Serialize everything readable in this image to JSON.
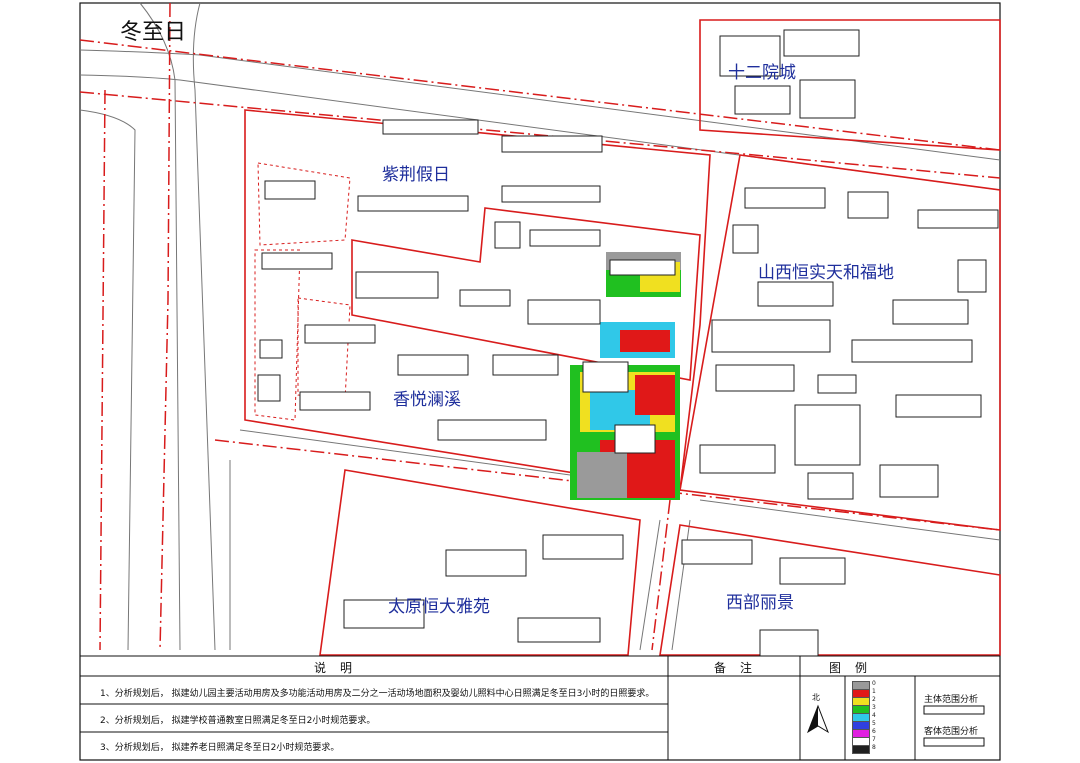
{
  "title": "冬至日",
  "districts": {
    "shierchengyuan": "十二院城",
    "zijingjiari": "紫荆假日",
    "shanxihengshi": "山西恒实天和福地",
    "xiangyuelanxi": "香悦澜溪",
    "taiyuanhengda": "太原恒大雅苑",
    "xibulijing": "西部丽景"
  },
  "title_block": {
    "explain_header": "说明",
    "remark_header": "备注",
    "legend_header": "图例",
    "notes": [
      "1、分析规划后， 拟建幼儿园主要活动用房及多功能活动用房及二分之一活动场地面积及婴幼儿照料中心日照满足冬至日3小时的日照要求。",
      "2、分析规划后， 拟建学校普通教室日照满足冬至日2小时规范要求。",
      "3、分析规划后， 拟建养老日照满足冬至日2小时规范要求。"
    ],
    "north_label": "北",
    "legend_main": "主体范围分析",
    "legend_guest": "客体范围分析",
    "legend_hours": [
      "0",
      "1",
      "2",
      "3",
      "4",
      "5",
      "6",
      "7",
      "8"
    ],
    "legend_colors": [
      "#9a9a9a",
      "#e01818",
      "#f0e020",
      "#20c020",
      "#30c8e8",
      "#3040e0",
      "#e020e0",
      "#ffffff",
      "#202020"
    ]
  },
  "colors": {
    "boundary": "#d81c1c",
    "label": "#1f2f9c",
    "building": "#222222"
  }
}
